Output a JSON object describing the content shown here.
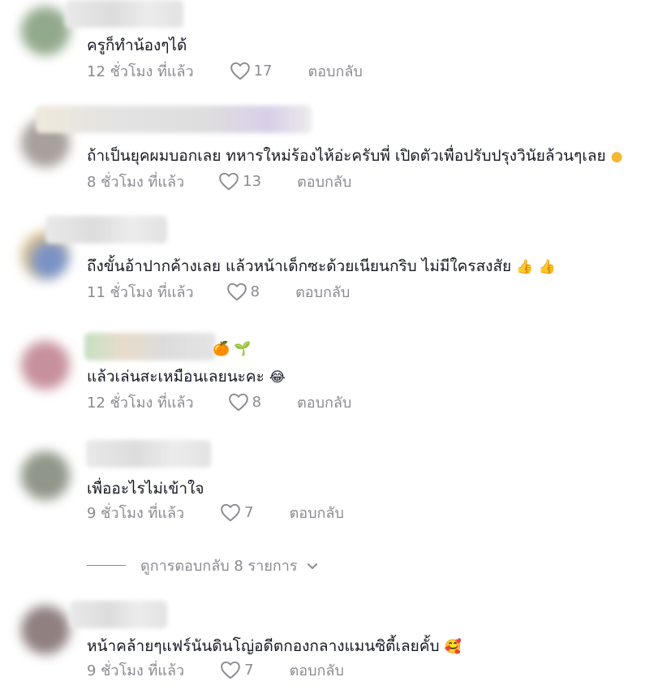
{
  "comments": [
    {
      "text": "ครูก็ทำน้องๆได้",
      "time": "12 ชั่วโมง ที่แล้ว",
      "likes": "17",
      "reply": "ตอบกลับ",
      "avatar_color": "#6f8d66"
    },
    {
      "text": "ถ้าเป็นยุคผมบอกเลย ทหารใหม่ร้องไห้อ่ะครับพี่ เปิดตัวเพื่อปรับปรุงวินัยล้วนๆเลย",
      "time": "8 ชั่วโมง ที่แล้ว",
      "likes": "13",
      "reply": "ตอบกลับ",
      "avatar_color": "#8a817b"
    },
    {
      "text": "ถึงขั้นอ้าปากค้างเลย แล้วหน้าเด็กซะด้วยเนียนกริบ ไม่มีใครสงสัย",
      "time": "11 ชั่วโมง ที่แล้ว",
      "likes": "8",
      "reply": "ตอบกลับ",
      "avatar_color": "#c9a86a"
    },
    {
      "text": "แล้วเล่นสะเหมือนเลยนะคะ",
      "time": "12 ชั่วโมง ที่แล้ว",
      "likes": "8",
      "reply": "ตอบกลับ",
      "avatar_color": "#b46d7c"
    },
    {
      "text": "เพื่ออะไรไม่เข้าใจ",
      "time": "9 ชั่วโมง ที่แล้ว",
      "likes": "7",
      "reply": "ตอบกลับ",
      "avatar_color": "#6c7462"
    },
    {
      "text": "หน้าคล้ายๆแฟร์นันดินโญ่อดีตกองกลางแมนซิตี้เลยคั้บ",
      "time": "9 ชั่วโมง ที่แล้ว",
      "likes": "7",
      "reply": "ตอบกลับ",
      "avatar_color": "#6b5656"
    }
  ],
  "view_replies": {
    "label": "ดูการตอบกลับ 8 รายการ"
  },
  "icons": {
    "like": "heart-outline-icon",
    "emoji_thumbs": "👍",
    "emoji_laugh": "😂",
    "emoji_hearts": "🥰",
    "emoji_orange": "🍊",
    "emoji_sprout": "🌱"
  }
}
